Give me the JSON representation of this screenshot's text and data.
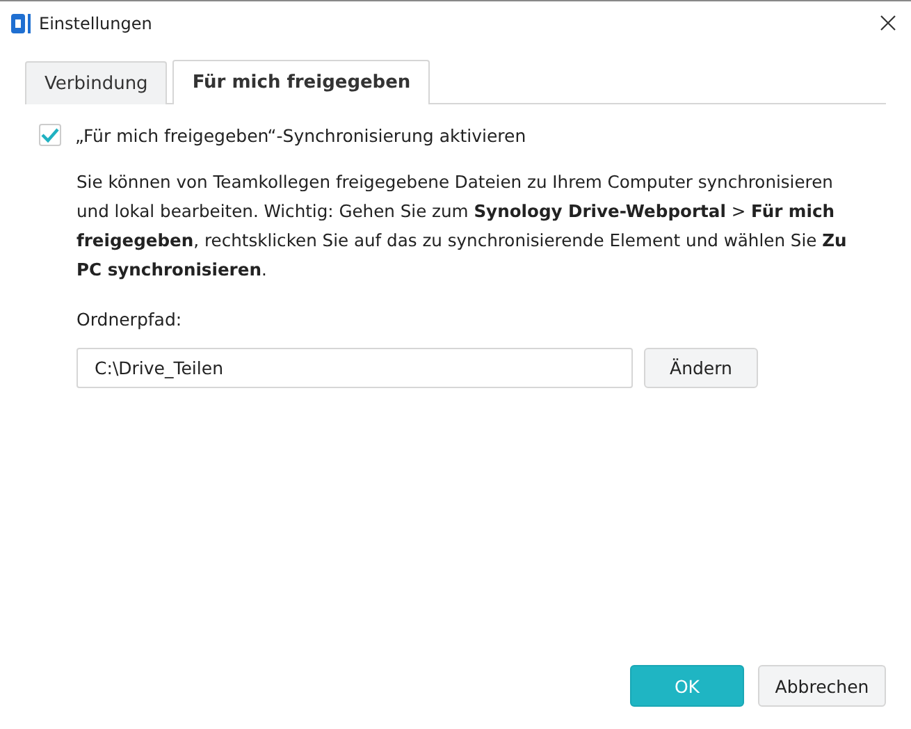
{
  "window": {
    "title": "Einstellungen"
  },
  "tabs": [
    {
      "label": "Verbindung",
      "selected": false
    },
    {
      "label": "Für mich freigegeben",
      "selected": true
    }
  ],
  "sync_option": {
    "label": "„Für mich freigegeben“-Synchronisierung aktivieren",
    "checked": true
  },
  "description": "Sie können von Teamkollegen freigegebene Dateien zu Ihrem Computer synchronisieren und lokal bearbeiten. Wichtig: Gehen Sie zum **Synology Drive-Webportal** > **Für mich freigegeben**, rechtsklicken Sie auf das zu synchronisierende Element und wählen Sie **Zu PC synchronisieren**.",
  "folder_path": {
    "label": "Ordnerpfad:",
    "value": "C:\\Drive_Teilen",
    "button": "Ändern"
  },
  "buttons": [
    {
      "label": "OK",
      "kind": "primary"
    },
    {
      "label": "Abbrechen",
      "kind": "secondary"
    }
  ]
}
